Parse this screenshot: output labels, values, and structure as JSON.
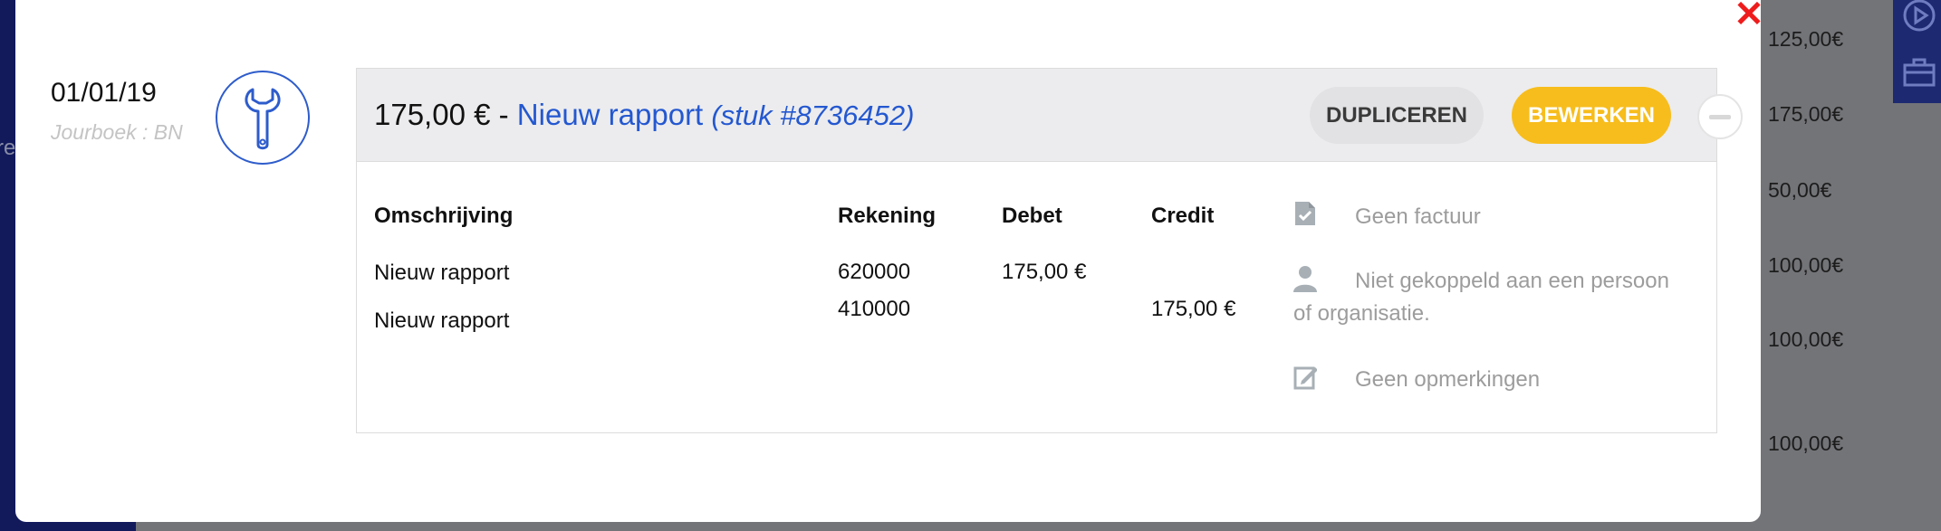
{
  "background": {
    "partial_text": "re",
    "amounts": [
      "125,00€",
      "175,00€",
      "50,00€",
      "100,00€",
      "100,00€",
      "100,00€"
    ],
    "icons": [
      "play-circle-icon",
      "toolbox-icon"
    ]
  },
  "modal": {
    "close_label": "✕",
    "entry": {
      "date": "01/01/19",
      "journal": "Jourboek : BN",
      "icon": "wrench-icon"
    },
    "header": {
      "amount": "175,00 €",
      "separator": " - ",
      "title": "Nieuw rapport",
      "piece": "(stuk #8736452)",
      "duplicate_label": "DUPLICEREN",
      "edit_label": "BEWERKEN"
    },
    "table": {
      "columns": [
        "Omschrijving",
        "Rekening",
        "Debet",
        "Credit"
      ],
      "rows": [
        {
          "description": "Nieuw rapport",
          "account": "620000",
          "debit": "175,00 €",
          "credit": ""
        },
        {
          "description": "Nieuw rapport",
          "account": "410000",
          "debit": "",
          "credit": "175,00 €"
        }
      ]
    },
    "side": {
      "invoice": "Geen factuur",
      "person": "Niet gekoppeld aan een persoon of organisatie.",
      "remarks": "Geen opmerkingen"
    }
  }
}
